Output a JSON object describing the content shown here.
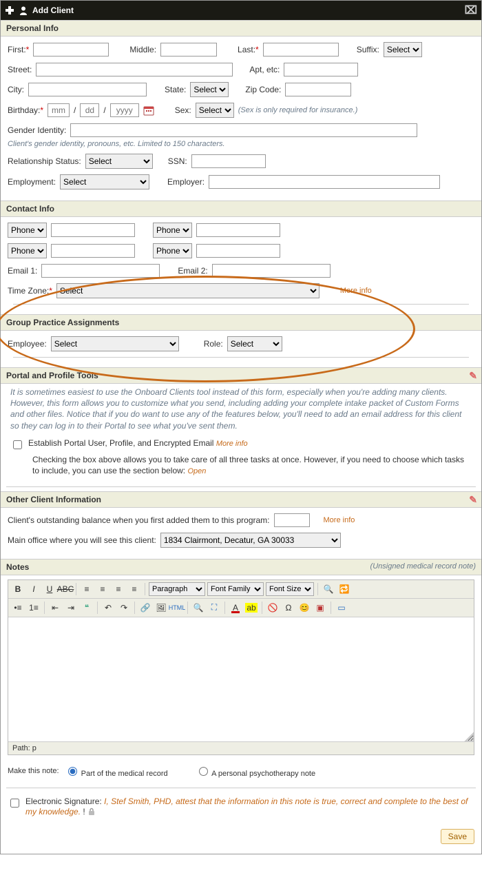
{
  "title": "Add Client",
  "sections": {
    "personal": "Personal Info",
    "contact": "Contact Info",
    "group": "Group Practice Assignments",
    "portal": "Portal and Profile Tools",
    "other": "Other Client Information",
    "notes": "Notes"
  },
  "personal": {
    "first": "First:",
    "middle": "Middle:",
    "last": "Last:",
    "suffix": "Suffix:",
    "suffix_sel": "Select",
    "street": "Street:",
    "apt": "Apt, etc:",
    "city": "City:",
    "state": "State:",
    "state_sel": "Select",
    "zip": "Zip Code:",
    "birthday": "Birthday:",
    "bmm": "mm",
    "bdd": "dd",
    "byy": "yyyy",
    "sex": "Sex:",
    "sex_sel": "Select",
    "sex_hint": "(Sex is only required for insurance.)",
    "gender": "Gender Identity:",
    "gender_hint": "Client's gender identity, pronouns, etc. Limited to 150 characters.",
    "relstatus": "Relationship Status:",
    "relstatus_sel": "Select",
    "ssn": "SSN:",
    "employment": "Employment:",
    "employment_sel": "Select",
    "employer": "Employer:"
  },
  "contact": {
    "phone_sel": "Phone",
    "email1": "Email 1:",
    "email2": "Email 2:",
    "tz": "Time Zone:",
    "tz_sel": "Select",
    "more": "More info"
  },
  "group": {
    "employee": "Employee:",
    "employee_sel": "Select",
    "role": "Role:",
    "role_sel": "Select"
  },
  "portal": {
    "intro": "It is sometimes easiest to use the Onboard Clients tool instead of this form, especially when you're adding many clients. However, this form allows you to customize what you send, including adding your complete intake packet of Custom Forms and other files. Notice that if you do want to use any of the features below, you'll need to add an email address for this client so they can log in to their Portal to see what you've sent them.",
    "cb_label": "Establish Portal User, Profile, and Encrypted Email",
    "cb_more": "More info",
    "sub": "Checking the box above allows you to take care of all three tasks at once. However, if you need to choose which tasks to include, you can use the section below: ",
    "open": "Open"
  },
  "other": {
    "balance_label": "Client's outstanding balance when you first added them to this program:",
    "balance_more": "More info",
    "office_label": "Main office where you will see this client:",
    "office_sel": "1834 Clairmont, Decatur, GA 30033"
  },
  "notes": {
    "subtitle": "(Unsigned medical record note)",
    "para_sel": "Paragraph",
    "ff_sel": "Font Family",
    "fs_sel": "Font Size",
    "path": "Path: p",
    "makenote": "Make this note:",
    "r1": "Part of the medical record",
    "r2": "A personal psychotherapy note"
  },
  "sig": {
    "label": "Electronic Signature:",
    "text": "I, Stef Smith, PHD, attest that the information in this note is true, correct and complete to the best of my knowledge.",
    "bang": "!"
  },
  "save": "Save"
}
